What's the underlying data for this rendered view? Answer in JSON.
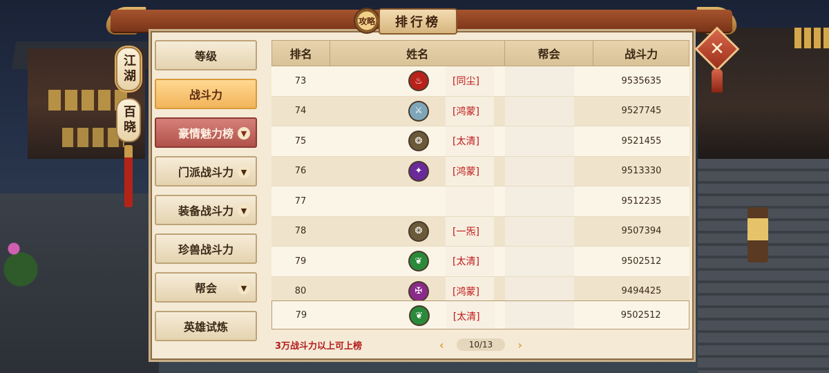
{
  "title": "排行榜",
  "emblem_text": "攻略",
  "close_label": "✕",
  "side_tabs": [
    {
      "label": "江湖",
      "active": true
    },
    {
      "label": "百晓",
      "active": false
    }
  ],
  "menu": [
    {
      "label": "等级",
      "state": "normal",
      "chevron": false
    },
    {
      "label": "战斗力",
      "state": "selected",
      "chevron": false
    },
    {
      "label": "豪情魅力榜",
      "state": "highlight",
      "chevron": true
    },
    {
      "label": "门派战斗力",
      "state": "normal",
      "chevron": true
    },
    {
      "label": "装备战斗力",
      "state": "normal",
      "chevron": true
    },
    {
      "label": "珍兽战斗力",
      "state": "normal",
      "chevron": false
    },
    {
      "label": "帮会",
      "state": "normal",
      "chevron": true
    },
    {
      "label": "英雄试炼",
      "state": "normal",
      "chevron": false
    }
  ],
  "table": {
    "headers": {
      "rank": "排名",
      "name": "姓名",
      "guild": "帮会",
      "power": "战斗力"
    },
    "rows": [
      {
        "rank": "73",
        "tag": "[同尘]",
        "power": "9535635",
        "icon": "flame-icon",
        "color": "#b8221a"
      },
      {
        "rank": "74",
        "tag": "[鸿蒙]",
        "power": "9527745",
        "icon": "blade-icon",
        "color": "#7fa6b8"
      },
      {
        "rank": "75",
        "tag": "[太清]",
        "power": "9521455",
        "icon": "mask-icon",
        "color": "#6a5a3a"
      },
      {
        "rank": "76",
        "tag": "[鸿蒙]",
        "power": "9513330",
        "icon": "spark-icon",
        "color": "#6a2a9a"
      },
      {
        "rank": "77",
        "tag": "",
        "power": "9512235",
        "icon": "",
        "color": ""
      },
      {
        "rank": "78",
        "tag": "[一炁]",
        "power": "9507394",
        "icon": "mask-icon",
        "color": "#6a5a3a"
      },
      {
        "rank": "79",
        "tag": "[太清]",
        "power": "9502512",
        "icon": "leaf-icon",
        "color": "#2a8a3a"
      },
      {
        "rank": "80",
        "tag": "[鸿蒙]",
        "power": "9494425",
        "icon": "sword-icon",
        "color": "#8a2a8a"
      }
    ],
    "self": {
      "rank": "79",
      "tag": "[太清]",
      "power": "9502512",
      "icon": "leaf-icon",
      "color": "#2a8a3a"
    }
  },
  "footer_note": "3万战斗力以上可上榜",
  "pager": {
    "current": "10/13",
    "prev": "‹",
    "next": "›"
  }
}
